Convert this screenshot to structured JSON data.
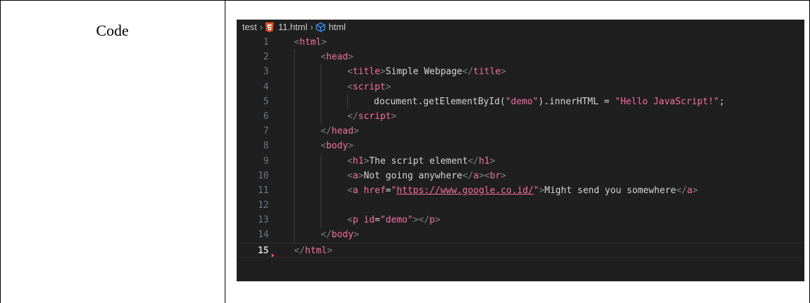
{
  "label": "Code",
  "breadcrumb": {
    "folder": "test",
    "file": "11.html",
    "symbol": "html"
  },
  "colors": {
    "editor_bg": "#1f1f1f",
    "tag": "#f470a0",
    "punctuation": "#808080",
    "text": "#d4d4d4",
    "line_number": "#6e7681"
  },
  "lines": [
    {
      "n": "1",
      "indent": 0,
      "tokens": [
        [
          "p",
          "<"
        ],
        [
          "t",
          "html"
        ],
        [
          "p",
          ">"
        ]
      ]
    },
    {
      "n": "2",
      "indent": 1,
      "tokens": [
        [
          "p",
          "<"
        ],
        [
          "t",
          "head"
        ],
        [
          "p",
          ">"
        ]
      ]
    },
    {
      "n": "3",
      "indent": 2,
      "tokens": [
        [
          "p",
          "<"
        ],
        [
          "t",
          "title"
        ],
        [
          "p",
          ">"
        ],
        [
          "x",
          "Simple Webpage"
        ],
        [
          "p",
          "</"
        ],
        [
          "t",
          "title"
        ],
        [
          "p",
          ">"
        ]
      ]
    },
    {
      "n": "4",
      "indent": 2,
      "tokens": [
        [
          "p",
          "<"
        ],
        [
          "t",
          "script"
        ],
        [
          "p",
          ">"
        ]
      ]
    },
    {
      "n": "5",
      "indent": 3,
      "tokens": [
        [
          "x",
          "document.getElementById("
        ],
        [
          "s",
          "\"demo\""
        ],
        [
          "x",
          ").innerHTML = "
        ],
        [
          "s",
          "\"Hello JavaScript!\""
        ],
        [
          "x",
          ";"
        ]
      ]
    },
    {
      "n": "6",
      "indent": 2,
      "tokens": [
        [
          "p",
          "</"
        ],
        [
          "t",
          "script"
        ],
        [
          "p",
          ">"
        ]
      ]
    },
    {
      "n": "7",
      "indent": 1,
      "tokens": [
        [
          "p",
          "</"
        ],
        [
          "t",
          "head"
        ],
        [
          "p",
          ">"
        ]
      ]
    },
    {
      "n": "8",
      "indent": 1,
      "tokens": [
        [
          "p",
          "<"
        ],
        [
          "t",
          "body"
        ],
        [
          "p",
          ">"
        ]
      ]
    },
    {
      "n": "9",
      "indent": 2,
      "tokens": [
        [
          "p",
          "<"
        ],
        [
          "t",
          "h1"
        ],
        [
          "p",
          ">"
        ],
        [
          "x",
          "The script element"
        ],
        [
          "p",
          "</"
        ],
        [
          "t",
          "h1"
        ],
        [
          "p",
          ">"
        ]
      ]
    },
    {
      "n": "10",
      "indent": 2,
      "tokens": [
        [
          "p",
          "<"
        ],
        [
          "t",
          "a"
        ],
        [
          "p",
          ">"
        ],
        [
          "x",
          "Not going anywhere"
        ],
        [
          "p",
          "</"
        ],
        [
          "t",
          "a"
        ],
        [
          "p",
          "><"
        ],
        [
          "t",
          "br"
        ],
        [
          "p",
          ">"
        ]
      ]
    },
    {
      "n": "11",
      "indent": 2,
      "tokens": [
        [
          "p",
          "<"
        ],
        [
          "t",
          "a"
        ],
        [
          "x",
          " "
        ],
        [
          "a",
          "href"
        ],
        [
          "x",
          "="
        ],
        [
          "s",
          "\""
        ],
        [
          "l",
          "https://www.google.co.id/"
        ],
        [
          "s",
          "\""
        ],
        [
          "p",
          ">"
        ],
        [
          "x",
          "Might send you somewhere"
        ],
        [
          "p",
          "</"
        ],
        [
          "t",
          "a"
        ],
        [
          "p",
          ">"
        ]
      ]
    },
    {
      "n": "12",
      "indent": 2,
      "tokens": []
    },
    {
      "n": "13",
      "indent": 2,
      "tokens": [
        [
          "p",
          "<"
        ],
        [
          "t",
          "p"
        ],
        [
          "x",
          " "
        ],
        [
          "a",
          "id"
        ],
        [
          "x",
          "="
        ],
        [
          "s",
          "\"demo\""
        ],
        [
          "p",
          "></"
        ],
        [
          "t",
          "p"
        ],
        [
          "p",
          ">"
        ]
      ]
    },
    {
      "n": "14",
      "indent": 1,
      "tokens": [
        [
          "p",
          "</"
        ],
        [
          "t",
          "body"
        ],
        [
          "p",
          ">"
        ]
      ]
    },
    {
      "n": "15",
      "indent": 0,
      "tokens": [
        [
          "p",
          "</"
        ],
        [
          "t",
          "html"
        ],
        [
          "p",
          ">"
        ]
      ],
      "active": true
    }
  ]
}
